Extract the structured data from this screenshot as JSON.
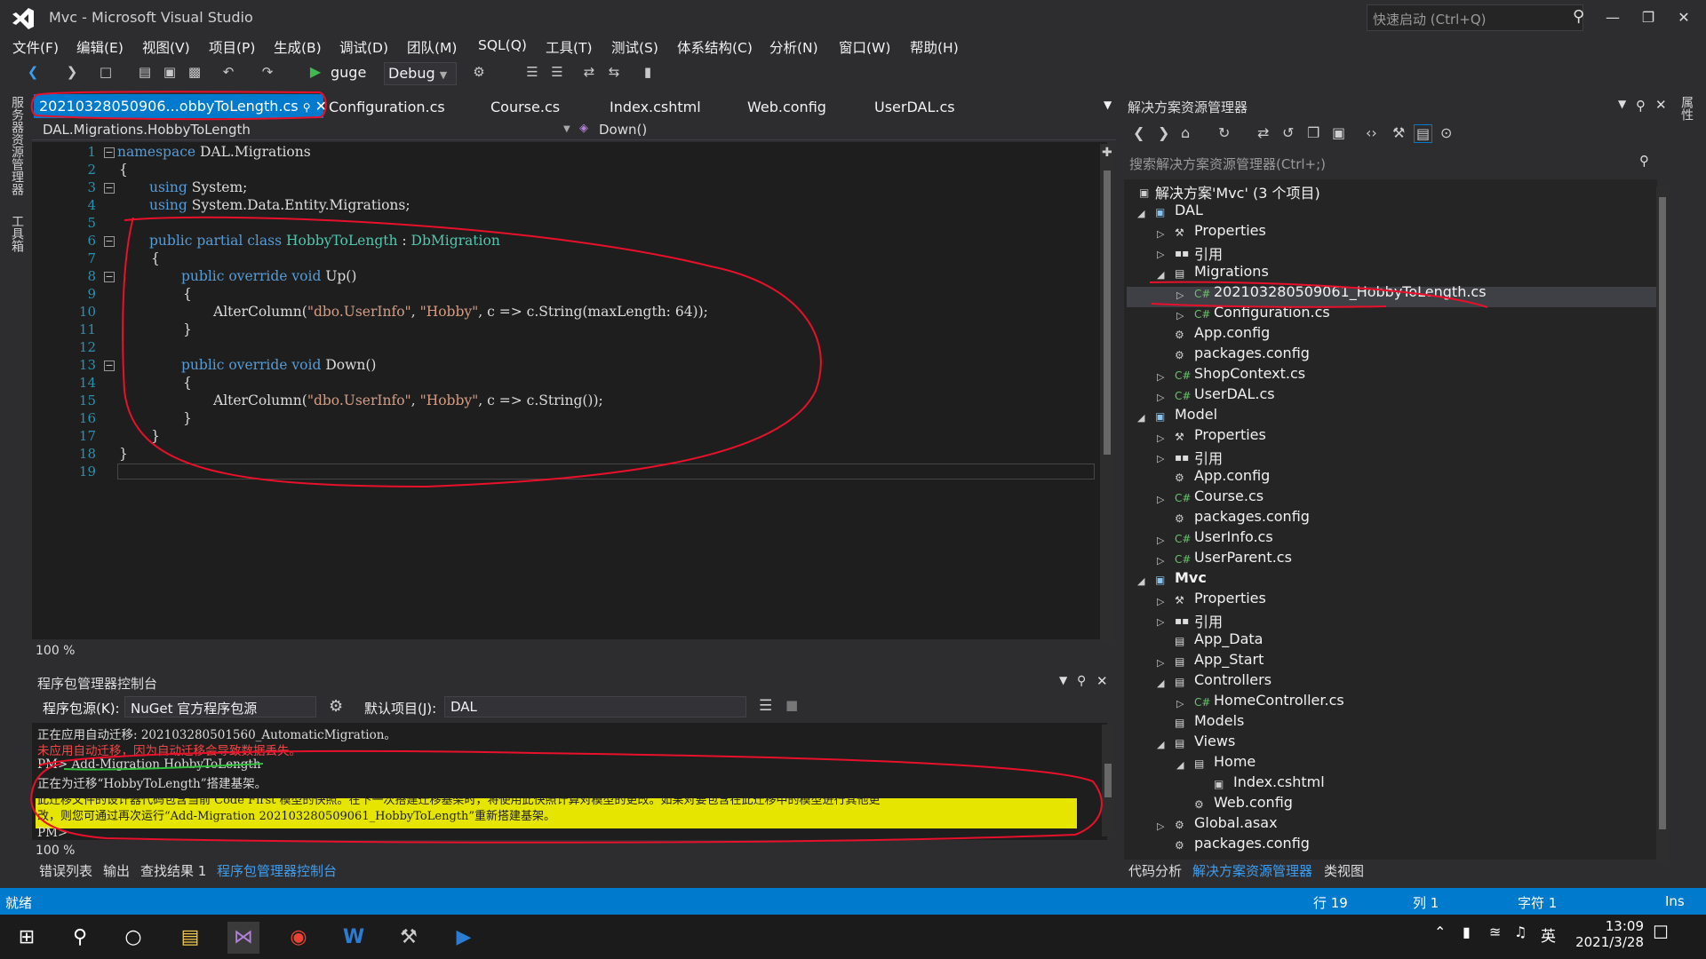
{
  "window": {
    "title": "Mvc - Microsoft Visual Studio",
    "quick_launch": "快速启动 (Ctrl+Q)"
  },
  "menu": [
    "文件(F)",
    "编辑(E)",
    "视图(V)",
    "项目(P)",
    "生成(B)",
    "调试(D)",
    "团队(M)",
    "SQL(Q)",
    "工具(T)",
    "测试(S)",
    "体系结构(C)",
    "分析(N)",
    "窗口(W)",
    "帮助(H)"
  ],
  "toolbar": {
    "run_target": "guge",
    "configuration": "Debug"
  },
  "side_panels": [
    "服务器资源管理器",
    "工具箱"
  ],
  "right_side_panel": "属性",
  "tabs": {
    "active": "20210328050906...obbyToLength.cs",
    "others": [
      "Configuration.cs",
      "Course.cs",
      "Index.cshtml",
      "Web.config",
      "UserDAL.cs"
    ]
  },
  "editor": {
    "nav_left": "DAL.Migrations.HobbyToLength",
    "nav_right": "Down()",
    "zoom": "100 %",
    "lines": [
      "1",
      "2",
      "3",
      "4",
      "5",
      "6",
      "7",
      "8",
      "9",
      "10",
      "11",
      "12",
      "13",
      "14",
      "15",
      "16",
      "17",
      "18",
      "19"
    ],
    "code": {
      "l1a": "namespace",
      "l1b": " DAL.Migrations",
      "l2": "{",
      "l3a": "using",
      "l3b": " System;",
      "l4a": "using",
      "l4b": " System.Data.Entity.Migrations;",
      "l6a": "public partial class",
      "l6b": "HobbyToLength",
      "l6c": " : ",
      "l6d": "DbMigration",
      "l7": "{",
      "l8a": "public override void",
      "l8b": " Up()",
      "l9": "{",
      "l10a": "AlterColumn(",
      "l10b": "\"dbo.UserInfo\"",
      "l10c": ", ",
      "l10d": "\"Hobby\"",
      "l10e": ", c => c.String(maxLength: 64));",
      "l11": "}",
      "l13a": "public override void",
      "l13b": " Down()",
      "l14": "{",
      "l15a": "AlterColumn(",
      "l15b": "\"dbo.UserInfo\"",
      "l15c": ", ",
      "l15d": "\"Hobby\"",
      "l15e": ", c => c.String());",
      "l16": "}",
      "l17": "}",
      "l18": "}"
    }
  },
  "package_manager": {
    "title": "程序包管理器控制台",
    "source_label": "程序包源(K):",
    "source_value": "NuGet 官方程序包源",
    "project_label": "默认项目(J):",
    "project_value": "DAL",
    "zoom": "100 %",
    "output": [
      "正在应用自动迁移: 202103280501560_AutomaticMigration。",
      "未应用自动迁移，因为自动迁移会导致数据丢失。",
      "PM> Add-Migration HobbyToLength",
      "正在为迁移“HobbyToLength”搭建基架。",
      "此迁移文件的设计器代码包含当前 Code First 模型的快照。在下一次搭建迁移基架时，将使用此快照计算对模型的更改。如果对要包含在此迁移中的模型进行其他更",
      "改，则您可通过再次运行“Add-Migration 202103280509061_HobbyToLength”重新搭建基架。",
      "PM>"
    ]
  },
  "bottom_tabs": [
    "错误列表",
    "输出",
    "查找结果 1",
    "程序包管理器控制台"
  ],
  "solution_explorer": {
    "title": "解决方案资源管理器",
    "search": "搜索解决方案资源管理器(Ctrl+;)",
    "nodes": [
      "解决方案'Mvc' (3 个项目)",
      "DAL",
      "Properties",
      "引用",
      "Migrations",
      "202103280509061_HobbyToLength.cs",
      "Configuration.cs",
      "App.config",
      "packages.config",
      "ShopContext.cs",
      "UserDAL.cs",
      "Model",
      "Properties",
      "引用",
      "App.config",
      "Course.cs",
      "packages.config",
      "UserInfo.cs",
      "UserParent.cs",
      "Mvc",
      "Properties",
      "引用",
      "App_Data",
      "App_Start",
      "Controllers",
      "HomeController.cs",
      "Models",
      "Views",
      "Home",
      "Index.cshtml",
      "Web.config",
      "Global.asax",
      "packages.config"
    ],
    "bottom_tabs": [
      "代码分析",
      "解决方案资源管理器",
      "类视图"
    ]
  },
  "status": {
    "state": "就绪",
    "row": "行 19",
    "col": "列 1",
    "char": "字符 1",
    "mode": "Ins"
  },
  "taskbar": {
    "time": "13:09",
    "date": "2021/3/28",
    "ime": "英"
  },
  "colors": {
    "accent": "#007acc",
    "annotation": "#e8102a",
    "annotation_green": "#2fbf3c",
    "highlight": "#e5e500"
  }
}
